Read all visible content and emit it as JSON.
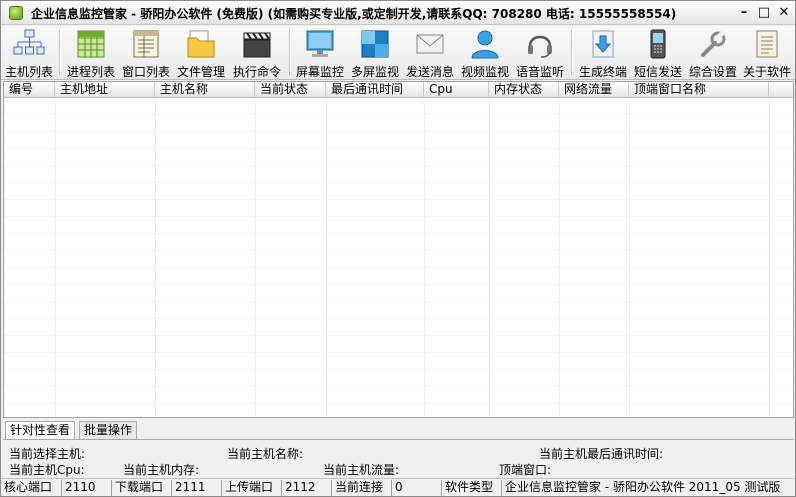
{
  "window": {
    "title": "企业信息监控管家 - 骄阳办公软件 (免费版) (如需购买专业版,或定制开发,请联系QQ: 708280 电话: 15555558554)",
    "minimize": "–",
    "maximize": "□",
    "close": "✕"
  },
  "toolbar": {
    "items": [
      {
        "label": "主机列表",
        "icon": "host-tree-icon"
      },
      {
        "label": "进程列表",
        "icon": "process-grid-icon"
      },
      {
        "label": "窗口列表",
        "icon": "window-list-icon"
      },
      {
        "label": "文件管理",
        "icon": "folder-icon"
      },
      {
        "label": "执行命令",
        "icon": "clapper-icon"
      },
      {
        "label": "屏幕监控",
        "icon": "monitor-icon"
      },
      {
        "label": "多屏监视",
        "icon": "multi-screen-icon"
      },
      {
        "label": "发送消息",
        "icon": "envelope-icon"
      },
      {
        "label": "视频监视",
        "icon": "user-icon"
      },
      {
        "label": "语音监听",
        "icon": "headset-icon"
      },
      {
        "label": "生成终端",
        "icon": "download-doc-icon"
      },
      {
        "label": "短信发送",
        "icon": "phone-icon"
      },
      {
        "label": "综合设置",
        "icon": "wrench-icon"
      },
      {
        "label": "关于软件",
        "icon": "about-doc-icon"
      }
    ]
  },
  "table": {
    "columns": [
      "编号",
      "主机地址",
      "主机名称",
      "当前状态",
      "最后通讯时间",
      "Cpu",
      "内存状态",
      "网络流量",
      "顶端窗口名称"
    ],
    "rows": []
  },
  "tabs": [
    "针对性查看",
    "批量操作"
  ],
  "info": {
    "selected_host": "当前选择主机:",
    "host_name": "当前主机名称:",
    "last_comm_time": "当前主机最后通讯时间:",
    "host_cpu": "当前主机Cpu:",
    "host_memory": "当前主机内存:",
    "host_traffic": "当前主机流量:",
    "top_window": "顶端窗口:"
  },
  "statusbar": {
    "core_port_label": "核心端口",
    "core_port": "2110",
    "download_port_label": "下载端口",
    "download_port": "2111",
    "upload_port_label": "上传端口",
    "upload_port": "2112",
    "connections_label": "当前连接",
    "connections": "0",
    "type_label": "软件类型",
    "type_value": "企业信息监控管家 - 骄阳办公软件 2011_05 测试版"
  }
}
